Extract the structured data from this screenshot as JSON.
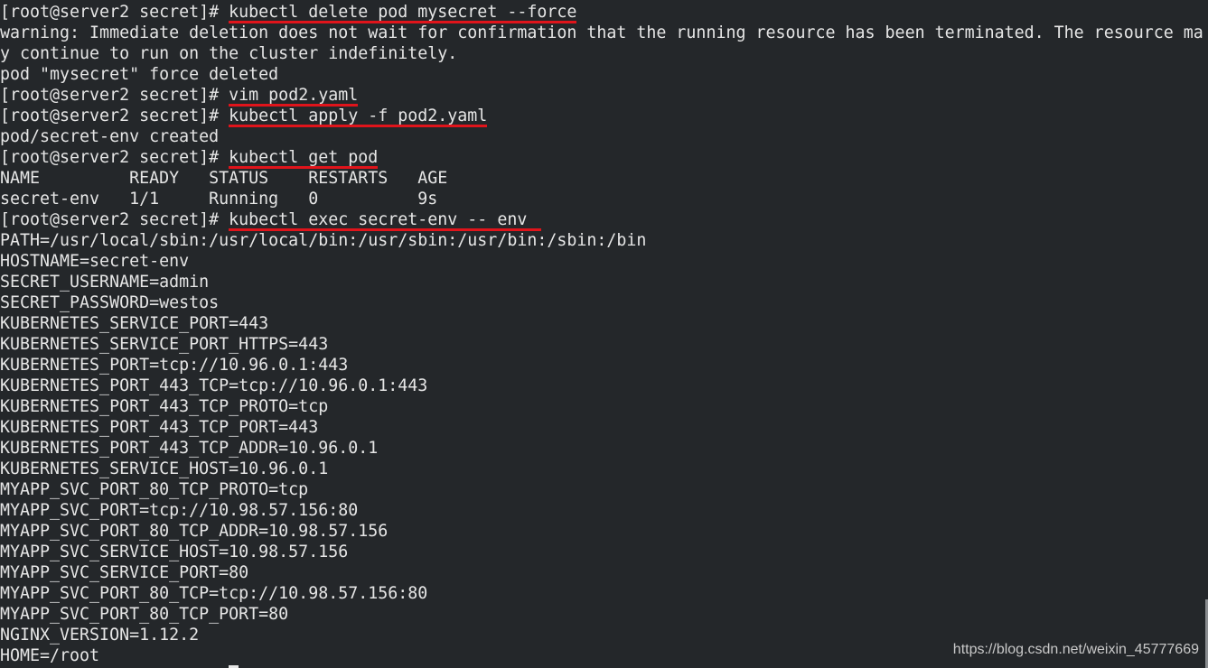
{
  "terminal": {
    "prompt": "[root@server2 secret]# ",
    "lines": [
      {
        "type": "command",
        "text": "kubectl delete pod mysecret --force"
      },
      {
        "type": "output",
        "text": "warning: Immediate deletion does not wait for confirmation that the running resource has been terminated. The resource ma"
      },
      {
        "type": "output",
        "text": "y continue to run on the cluster indefinitely."
      },
      {
        "type": "output",
        "text": "pod \"mysecret\" force deleted"
      },
      {
        "type": "command",
        "text": "vim pod2.yaml"
      },
      {
        "type": "command",
        "text": "kubectl apply -f pod2.yaml"
      },
      {
        "type": "output",
        "text": "pod/secret-env created"
      },
      {
        "type": "command",
        "text": "kubectl get pod"
      },
      {
        "type": "output",
        "text": "NAME         READY   STATUS    RESTARTS   AGE"
      },
      {
        "type": "output",
        "text": "secret-env   1/1     Running   0          9s"
      },
      {
        "type": "command",
        "text": "kubectl exec secret-env -- env"
      },
      {
        "type": "output",
        "text": "PATH=/usr/local/sbin:/usr/local/bin:/usr/sbin:/usr/bin:/sbin:/bin"
      },
      {
        "type": "output",
        "text": "HOSTNAME=secret-env"
      },
      {
        "type": "output",
        "text": "SECRET_USERNAME=admin"
      },
      {
        "type": "output",
        "text": "SECRET_PASSWORD=westos"
      },
      {
        "type": "output",
        "text": "KUBERNETES_SERVICE_PORT=443"
      },
      {
        "type": "output",
        "text": "KUBERNETES_SERVICE_PORT_HTTPS=443"
      },
      {
        "type": "output",
        "text": "KUBERNETES_PORT=tcp://10.96.0.1:443"
      },
      {
        "type": "output",
        "text": "KUBERNETES_PORT_443_TCP=tcp://10.96.0.1:443"
      },
      {
        "type": "output",
        "text": "KUBERNETES_PORT_443_TCP_PROTO=tcp"
      },
      {
        "type": "output",
        "text": "KUBERNETES_PORT_443_TCP_PORT=443"
      },
      {
        "type": "output",
        "text": "KUBERNETES_PORT_443_TCP_ADDR=10.96.0.1"
      },
      {
        "type": "output",
        "text": "KUBERNETES_SERVICE_HOST=10.96.0.1"
      },
      {
        "type": "output",
        "text": "MYAPP_SVC_PORT_80_TCP_PROTO=tcp"
      },
      {
        "type": "output",
        "text": "MYAPP_SVC_PORT=tcp://10.98.57.156:80"
      },
      {
        "type": "output",
        "text": "MYAPP_SVC_PORT_80_TCP_ADDR=10.98.57.156"
      },
      {
        "type": "output",
        "text": "MYAPP_SVC_SERVICE_HOST=10.98.57.156"
      },
      {
        "type": "output",
        "text": "MYAPP_SVC_SERVICE_PORT=80"
      },
      {
        "type": "output",
        "text": "MYAPP_SVC_PORT_80_TCP=tcp://10.98.57.156:80"
      },
      {
        "type": "output",
        "text": "MYAPP_SVC_PORT_80_TCP_PORT=80"
      },
      {
        "type": "output",
        "text": "NGINX_VERSION=1.12.2"
      },
      {
        "type": "output",
        "text": "HOME=/root"
      }
    ]
  },
  "watermark": "https://blog.csdn.net/weixin_45777669",
  "colors": {
    "background": "#24272a",
    "foreground": "#e6e6e6",
    "underline": "#e0141b"
  }
}
